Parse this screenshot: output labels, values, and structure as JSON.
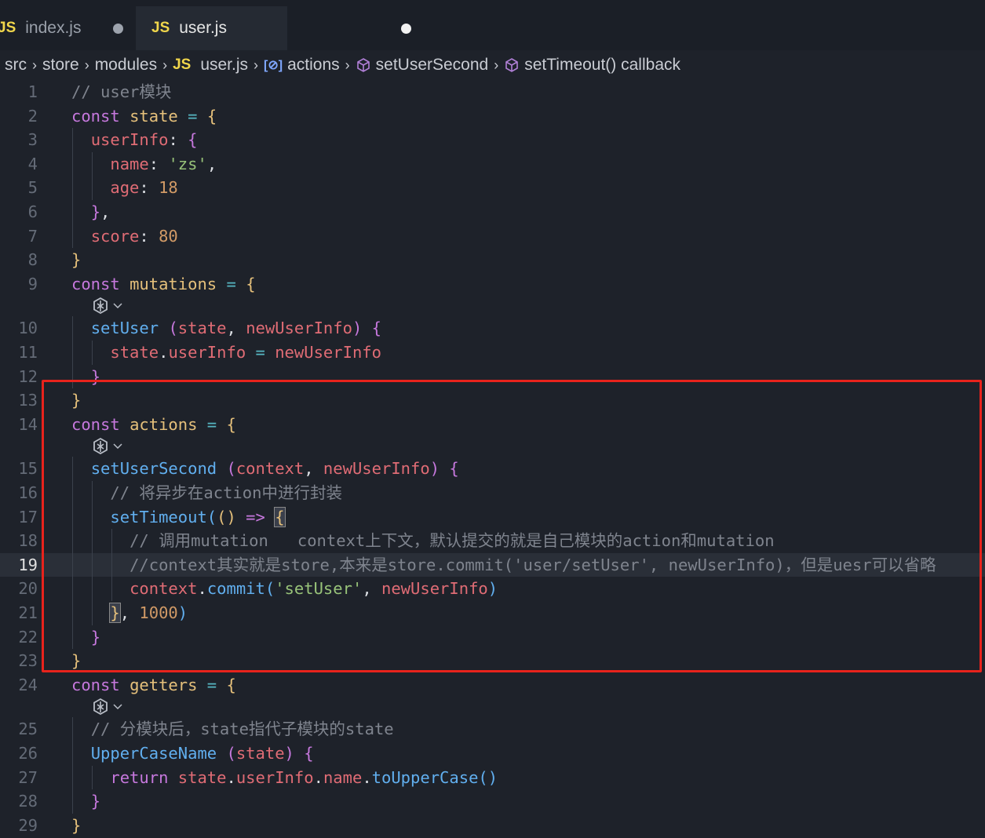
{
  "tabs": [
    {
      "badge": "JS",
      "label": "index.js",
      "active": false,
      "modified": true
    },
    {
      "badge": "JS",
      "label": "user.js",
      "active": true,
      "modified": true
    }
  ],
  "breadcrumb": {
    "parts": [
      "src",
      "store",
      "modules",
      "user.js",
      "actions",
      "setUserSecond",
      "setTimeout() callback"
    ],
    "js_badge": "JS"
  },
  "editor": {
    "current_line": "19",
    "lines": [
      {
        "n": "1",
        "tokens": [
          [
            "cm",
            "// user模块"
          ]
        ]
      },
      {
        "n": "2",
        "tokens": [
          [
            "kw",
            "const "
          ],
          [
            "var",
            "state"
          ],
          [
            "op",
            " = "
          ],
          [
            "b1",
            "{"
          ]
        ]
      },
      {
        "n": "3",
        "tokens": [
          [
            "pn",
            "  "
          ],
          [
            "prop",
            "userInfo"
          ],
          [
            "pn",
            ": "
          ],
          [
            "b2",
            "{"
          ]
        ]
      },
      {
        "n": "4",
        "tokens": [
          [
            "pn",
            "    "
          ],
          [
            "prop",
            "name"
          ],
          [
            "pn",
            ": "
          ],
          [
            "str",
            "'zs'"
          ],
          [
            "pn",
            ","
          ]
        ]
      },
      {
        "n": "5",
        "tokens": [
          [
            "pn",
            "    "
          ],
          [
            "prop",
            "age"
          ],
          [
            "pn",
            ": "
          ],
          [
            "num",
            "18"
          ]
        ]
      },
      {
        "n": "6",
        "tokens": [
          [
            "pn",
            "  "
          ],
          [
            "b2",
            "}"
          ],
          [
            "pn",
            ","
          ]
        ]
      },
      {
        "n": "7",
        "tokens": [
          [
            "pn",
            "  "
          ],
          [
            "prop",
            "score"
          ],
          [
            "pn",
            ": "
          ],
          [
            "num",
            "80"
          ]
        ]
      },
      {
        "n": "8",
        "tokens": [
          [
            "b1",
            "}"
          ]
        ]
      },
      {
        "n": "9",
        "tokens": [
          [
            "kw",
            "const "
          ],
          [
            "var",
            "mutations"
          ],
          [
            "op",
            " = "
          ],
          [
            "b1",
            "{"
          ]
        ]
      },
      {
        "n": "10",
        "tokens": [
          [
            "pn",
            "  "
          ],
          [
            "fn",
            "setUser"
          ],
          [
            "pn",
            " "
          ],
          [
            "b2",
            "("
          ],
          [
            "prop",
            "state"
          ],
          [
            "pn",
            ", "
          ],
          [
            "prop",
            "newUserInfo"
          ],
          [
            "b2",
            ")"
          ],
          [
            "pn",
            " "
          ],
          [
            "b2",
            "{"
          ]
        ]
      },
      {
        "n": "11",
        "tokens": [
          [
            "pn",
            "    "
          ],
          [
            "prop",
            "state"
          ],
          [
            "pn",
            "."
          ],
          [
            "prop",
            "userInfo"
          ],
          [
            "op",
            " = "
          ],
          [
            "prop",
            "newUserInfo"
          ]
        ]
      },
      {
        "n": "12",
        "tokens": [
          [
            "pn",
            "  "
          ],
          [
            "b2",
            "}"
          ]
        ]
      },
      {
        "n": "13",
        "tokens": [
          [
            "b1",
            "}"
          ]
        ]
      },
      {
        "n": "14",
        "tokens": [
          [
            "kw",
            "const "
          ],
          [
            "var",
            "actions"
          ],
          [
            "op",
            " = "
          ],
          [
            "b1",
            "{"
          ]
        ]
      },
      {
        "n": "15",
        "tokens": [
          [
            "pn",
            "  "
          ],
          [
            "fn",
            "setUserSecond"
          ],
          [
            "pn",
            " "
          ],
          [
            "b2",
            "("
          ],
          [
            "prop",
            "context"
          ],
          [
            "pn",
            ", "
          ],
          [
            "prop",
            "newUserInfo"
          ],
          [
            "b2",
            ")"
          ],
          [
            "pn",
            " "
          ],
          [
            "b2",
            "{"
          ]
        ]
      },
      {
        "n": "16",
        "tokens": [
          [
            "pn",
            "    "
          ],
          [
            "cm",
            "// 将异步在action中进行封装"
          ]
        ]
      },
      {
        "n": "17",
        "tokens": [
          [
            "pn",
            "    "
          ],
          [
            "fn",
            "setTimeout"
          ],
          [
            "b3",
            "("
          ],
          [
            "b1",
            "()"
          ],
          [
            "pn",
            " "
          ],
          [
            "kw",
            "=>"
          ],
          [
            "pn",
            " "
          ],
          [
            "b1m",
            "{"
          ]
        ]
      },
      {
        "n": "18",
        "tokens": [
          [
            "pn",
            "      "
          ],
          [
            "cm",
            "// 调用mutation   context上下文，默认提交的就是自己模块的action和mutation"
          ]
        ]
      },
      {
        "n": "19",
        "tokens": [
          [
            "pn",
            "      "
          ],
          [
            "cm",
            "//context其实就是store,本来是store.commit('user/setUser', newUserInfo)，但是uesr可以省略"
          ]
        ]
      },
      {
        "n": "20",
        "tokens": [
          [
            "pn",
            "      "
          ],
          [
            "prop",
            "context"
          ],
          [
            "pn",
            "."
          ],
          [
            "fn",
            "commit"
          ],
          [
            "b3",
            "("
          ],
          [
            "str",
            "'setUser'"
          ],
          [
            "pn",
            ", "
          ],
          [
            "prop",
            "newUserInfo"
          ],
          [
            "b3",
            ")"
          ]
        ]
      },
      {
        "n": "21",
        "tokens": [
          [
            "pn",
            "    "
          ],
          [
            "b1m",
            "}"
          ],
          [
            "pn",
            ", "
          ],
          [
            "num",
            "1000"
          ],
          [
            "b3",
            ")"
          ]
        ]
      },
      {
        "n": "22",
        "tokens": [
          [
            "pn",
            "  "
          ],
          [
            "b2",
            "}"
          ]
        ]
      },
      {
        "n": "23",
        "tokens": [
          [
            "b1",
            "}"
          ]
        ]
      },
      {
        "n": "24",
        "tokens": [
          [
            "kw",
            "const "
          ],
          [
            "var",
            "getters"
          ],
          [
            "op",
            " = "
          ],
          [
            "b1",
            "{"
          ]
        ]
      },
      {
        "n": "25",
        "tokens": [
          [
            "pn",
            "  "
          ],
          [
            "cm",
            "// 分模块后，state指代子模块的state"
          ]
        ]
      },
      {
        "n": "26",
        "tokens": [
          [
            "pn",
            "  "
          ],
          [
            "fn",
            "UpperCaseName"
          ],
          [
            "pn",
            " "
          ],
          [
            "b2",
            "("
          ],
          [
            "prop",
            "state"
          ],
          [
            "b2",
            ")"
          ],
          [
            "pn",
            " "
          ],
          [
            "b2",
            "{"
          ]
        ]
      },
      {
        "n": "27",
        "tokens": [
          [
            "pn",
            "    "
          ],
          [
            "kw",
            "return "
          ],
          [
            "prop",
            "state"
          ],
          [
            "pn",
            "."
          ],
          [
            "prop",
            "userInfo"
          ],
          [
            "pn",
            "."
          ],
          [
            "prop",
            "name"
          ],
          [
            "pn",
            "."
          ],
          [
            "fn",
            "toUpperCase"
          ],
          [
            "b3",
            "()"
          ]
        ]
      },
      {
        "n": "28",
        "tokens": [
          [
            "pn",
            "  "
          ],
          [
            "b2",
            "}"
          ]
        ]
      },
      {
        "n": "29",
        "tokens": [
          [
            "b1",
            "}"
          ]
        ]
      }
    ]
  },
  "icons": {
    "codelens": "ai-assistant-icon",
    "chevron": "chevron-down-icon"
  }
}
